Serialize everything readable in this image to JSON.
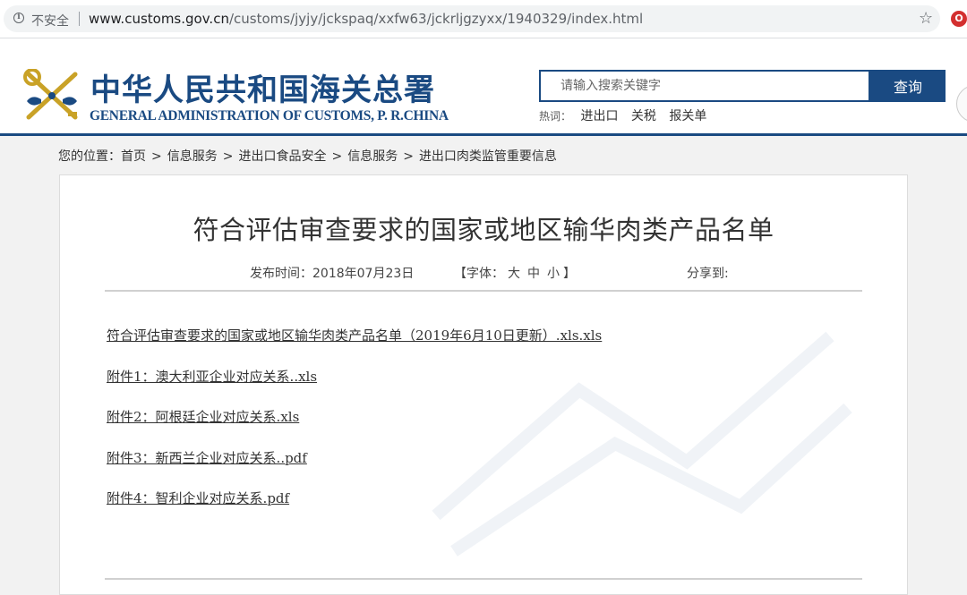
{
  "browser": {
    "security_label": "不安全",
    "url_host": "www.customs.gov.cn",
    "url_path": "/customs/jyjy/jckspaq/xxfw63/jckrljgzyxx/1940329/index.html",
    "info_icon": "info-icon",
    "bookmark_icon": "star-icon",
    "extension_icon": "extension-icon"
  },
  "header": {
    "title_cn": "中华人民共和国海关总署",
    "title_en": "GENERAL ADMINISTRATION OF CUSTOMS, P. R.CHINA",
    "brand_color": "#1a4a82",
    "search": {
      "placeholder": "请输入搜索关键字",
      "button_label": "查询"
    },
    "hot_label": "热词：",
    "hot_words": [
      "进出口",
      "关税",
      "报关单"
    ]
  },
  "breadcrumb": {
    "prefix": "您的位置：",
    "items": [
      "首页",
      "信息服务",
      "进出口食品安全",
      "信息服务",
      "进出口肉类监管重要信息"
    ],
    "separator": ">"
  },
  "article": {
    "title": "符合评估审查要求的国家或地区输华肉类产品名单",
    "publish_label": "发布时间：2018年07月23日",
    "font_label_open": "【字体：",
    "font_sizes": [
      "大",
      "中",
      "小"
    ],
    "font_label_close": "】",
    "share_label": "分享到:",
    "attachments": [
      "符合评估审查要求的国家或地区输华肉类产品名单（2019年6月10日更新）.xls.xls",
      "附件1：澳大利亚企业对应关系..xls",
      "附件2：阿根廷企业对应关系.xls",
      "附件3：新西兰企业对应关系..pdf",
      "附件4：智利企业对应关系.pdf"
    ]
  }
}
